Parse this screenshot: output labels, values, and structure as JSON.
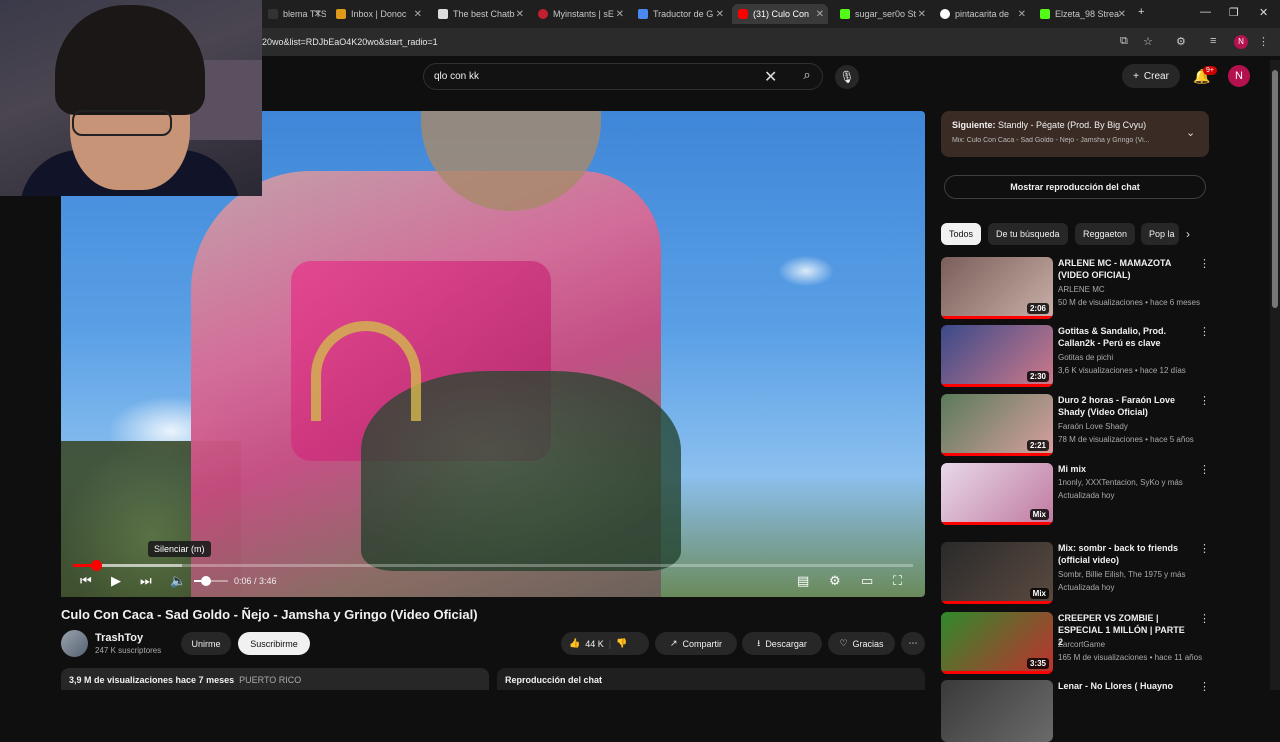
{
  "browser": {
    "tabs": [
      {
        "label": "blema TTS",
        "color": "#333333"
      },
      {
        "label": "Inbox | Donoc",
        "color": "#e09a1a"
      },
      {
        "label": "The best Chatb",
        "color": "#dddddd"
      },
      {
        "label": "Myinstants | sE",
        "color": "#c02030"
      },
      {
        "label": "Traductor de G",
        "color": "#4a8af0"
      },
      {
        "label": "(31) Culo Con",
        "color": "#ff0000"
      },
      {
        "label": "sugar_ser0o St",
        "color": "#53fc18"
      },
      {
        "label": "pintacarita de",
        "color": "#ffffff"
      },
      {
        "label": "Elzeta_98 Strea",
        "color": "#53fc18"
      }
    ],
    "new_tab": "+",
    "url": "20wo&list=RDJbEaO4K20wo&start_radio=1",
    "profile": "N"
  },
  "youtube": {
    "search_value": "qlo con kk",
    "create_label": "Crear",
    "notif_badge": "9+",
    "avatar_letter": "N"
  },
  "player": {
    "tooltip": "Silenciar (m)",
    "current_time": "0:06 / 3:46",
    "progress_fraction": 0.027,
    "buffer_fraction": 0.13,
    "volume_fraction": 0.35
  },
  "video": {
    "title": "Culo Con Caca - Sad Goldo - Ñejo - Jamsha y Gringo (Video Oficial)",
    "channel": "TrashToy",
    "subscribers": "247 K suscriptores",
    "join_label": "Unirme",
    "subscribe_label": "Suscribirme",
    "likes": "44 K",
    "share_label": "Compartir",
    "download_label": "Descargar",
    "thanks_label": "Gracias",
    "views_line": "3,9 M de visualizaciones  hace 7 meses",
    "place": "PUERTO RICO",
    "chat_replay": "Reproducción del chat"
  },
  "sidebar": {
    "next_label": "Siguiente:",
    "next_title": "Standly - Pégate (Prod. By Big Cvyu)",
    "next_sub": "Mix: Culo Con Caca - Sad Goldo - Ñejo - Jamsha y Gringo (Vi...",
    "chat_button": "Mostrar reproducción del chat",
    "chips": [
      "Todos",
      "De tu búsqueda",
      "Reggaeton",
      "Pop la"
    ],
    "recs": [
      {
        "title": "ARLENE MC - MAMAZOTA (VIDEO OFICIAL)",
        "channel": "ARLENE MC",
        "meta": "50 M de visualizaciones • hace 6 meses",
        "badge": "2:06",
        "colors": [
          "#7b5e5a",
          "#c9b0a8"
        ]
      },
      {
        "title": "Gotitas & Sandalio, Prod. Callan2k - Perú es clave",
        "channel": "Gotitas de pichi",
        "meta": "3,6 K visualizaciones • hace 12 días",
        "badge": "2:30",
        "colors": [
          "#3a4a8a",
          "#d07a8a"
        ]
      },
      {
        "title": "Duro 2 horas - Faraón Love Shady (Video Oficial)",
        "channel": "Faraón Love Shady",
        "meta": "78 M de visualizaciones • hace 5 años",
        "badge": "2:21",
        "colors": [
          "#5a7a5a",
          "#d8a0a0"
        ]
      },
      {
        "title": "Mi mix",
        "channel": "1nonly, XXXTentacion, SyKo y más",
        "meta": "Actualizada hoy",
        "badge": "Mix",
        "colors": [
          "#e8d8e8",
          "#c07aa0"
        ]
      },
      {
        "title": "Mix: sombr - back to friends (official video)",
        "channel": "Sombr, Billie Eilish, The 1975 y más",
        "meta": "Actualizada hoy",
        "badge": "Mix",
        "colors": [
          "#2a2a2a",
          "#5a4a40"
        ]
      },
      {
        "title": "CREEPER VS ZOMBIE | ESPECIAL 1 MILLÓN | PARTE 2",
        "channel": "ZarcortGame",
        "meta": "165 M de visualizaciones • hace 11 años",
        "badge": "3:35",
        "colors": [
          "#2f8a2a",
          "#c03030"
        ]
      },
      {
        "title": "Lenar - No Llores ( Huayno",
        "channel": "",
        "meta": "",
        "badge": "",
        "colors": [
          "#3a3a3a",
          "#6a6a6a"
        ]
      }
    ]
  }
}
